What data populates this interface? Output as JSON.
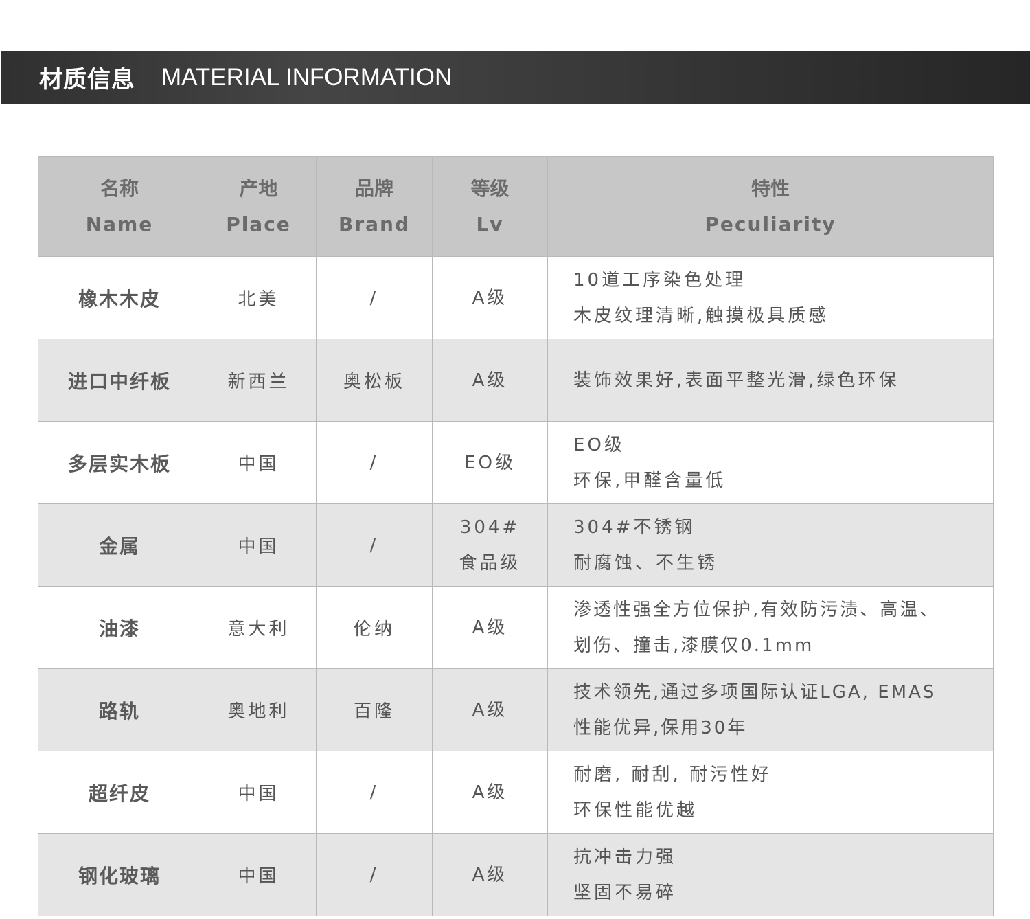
{
  "banner": {
    "title_cn": "材质信息",
    "title_en": "MATERIAL INFORMATION"
  },
  "table": {
    "headers": [
      {
        "cn": "名称",
        "en": "Name"
      },
      {
        "cn": "产地",
        "en": "Place"
      },
      {
        "cn": "品牌",
        "en": "Brand"
      },
      {
        "cn": "等级",
        "en": "Lv"
      },
      {
        "cn": "特性",
        "en": "Peculiarity"
      }
    ],
    "rows": [
      {
        "name": "橡木木皮",
        "place": "北美",
        "brand": "/",
        "lv": [
          "A级"
        ],
        "features": [
          "10道工序染色处理",
          "木皮纹理清晰,触摸极具质感"
        ]
      },
      {
        "name": "进口中纤板",
        "place": "新西兰",
        "brand": "奥松板",
        "lv": [
          "A级"
        ],
        "features": [
          "装饰效果好,表面平整光滑,绿色环保"
        ]
      },
      {
        "name": "多层实木板",
        "place": "中国",
        "brand": "/",
        "lv": [
          "EO级"
        ],
        "features": [
          "EO级",
          "环保,甲醛含量低"
        ]
      },
      {
        "name": "金属",
        "place": "中国",
        "brand": "/",
        "lv": [
          "304#",
          "食品级"
        ],
        "features": [
          "304#不锈钢",
          "耐腐蚀、不生锈"
        ]
      },
      {
        "name": "油漆",
        "place": "意大利",
        "brand": "伦纳",
        "lv": [
          "A级"
        ],
        "features": [
          "渗透性强全方位保护,有效防污渍、高温、",
          "划伤、撞击,漆膜仅0.1mm"
        ]
      },
      {
        "name": "路轨",
        "place": "奥地利",
        "brand": "百隆",
        "lv": [
          "A级"
        ],
        "features": [
          "技术领先,通过多项国际认证LGA, EMAS",
          "性能优异,保用30年"
        ]
      },
      {
        "name": "超纤皮",
        "place": "中国",
        "brand": "/",
        "lv": [
          "A级"
        ],
        "features": [
          "耐磨, 耐刮, 耐污性好",
          "环保性能优越"
        ]
      },
      {
        "name": "钢化玻璃",
        "place": "中国",
        "brand": "/",
        "lv": [
          "A级"
        ],
        "features": [
          "抗冲击力强",
          "坚固不易碎"
        ]
      }
    ]
  }
}
